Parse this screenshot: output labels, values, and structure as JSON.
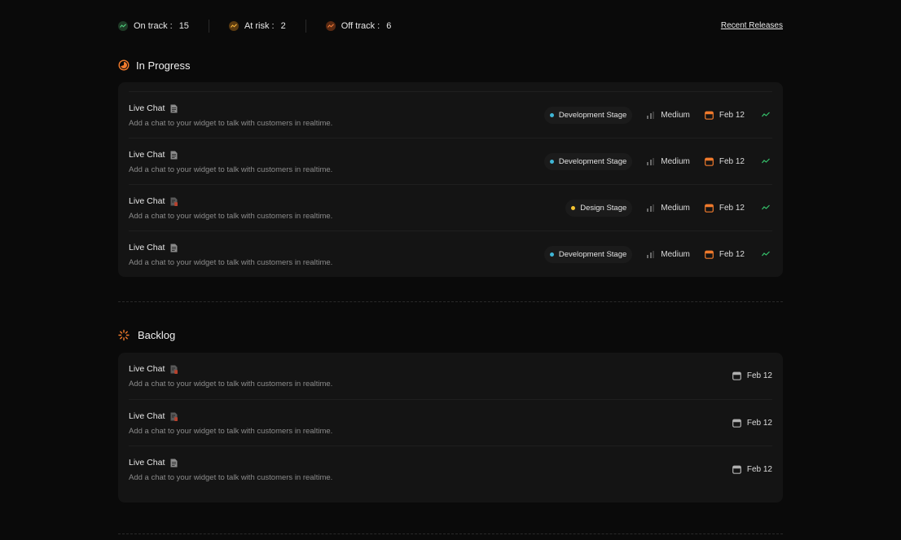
{
  "status": {
    "on_track": {
      "label": "On track :",
      "count": "15",
      "color": "#3a7a4e"
    },
    "at_risk": {
      "label": "At risk :",
      "count": "2",
      "color": "#c7821a"
    },
    "off_track": {
      "label": "Off track :",
      "count": "6",
      "color": "#c45a1a"
    },
    "recent_releases": "Recent Releases"
  },
  "in_progress": {
    "title": "In Progress",
    "icon": "progress-clock-icon",
    "rows": [
      {
        "title": "Live Chat",
        "desc": "Add a chat to your widget to talk with customers in realtime.",
        "doc_icon": "document-icon",
        "stage": "Development Stage",
        "stage_color": "#3fb6d6",
        "priority": "Medium",
        "date": "Feb 12"
      },
      {
        "title": "Live Chat",
        "desc": "Add a chat to your widget to talk with customers in realtime.",
        "doc_icon": "document-icon",
        "stage": "Development Stage",
        "stage_color": "#3fb6d6",
        "priority": "Medium",
        "date": "Feb 12"
      },
      {
        "title": "Live Chat",
        "desc": "Add a chat to your widget to talk with customers in realtime.",
        "doc_icon": "document-alert-icon",
        "stage": "Design Stage",
        "stage_color": "#f5c431",
        "priority": "Medium",
        "date": "Feb 12"
      },
      {
        "title": "Live Chat",
        "desc": "Add a chat to your widget to talk with customers in realtime.",
        "doc_icon": "document-icon",
        "stage": "Development Stage",
        "stage_color": "#3fb6d6",
        "priority": "Medium",
        "date": "Feb 12"
      }
    ]
  },
  "backlog": {
    "title": "Backlog",
    "icon": "backlog-spinner-icon",
    "rows": [
      {
        "title": "Live Chat",
        "desc": "Add a chat to your widget to talk with customers in realtime.",
        "doc_icon": "document-alert-icon",
        "date": "Feb 12"
      },
      {
        "title": "Live Chat",
        "desc": "Add a chat to your widget to talk with customers in realtime.",
        "doc_icon": "document-alert-icon",
        "date": "Feb 12"
      },
      {
        "title": "Live Chat",
        "desc": "Add a chat to your widget to talk with customers in realtime.",
        "doc_icon": "document-icon",
        "date": "Feb 12"
      }
    ]
  },
  "colors": {
    "accent_orange": "#f07a2c",
    "trend_green": "#35c06a"
  }
}
